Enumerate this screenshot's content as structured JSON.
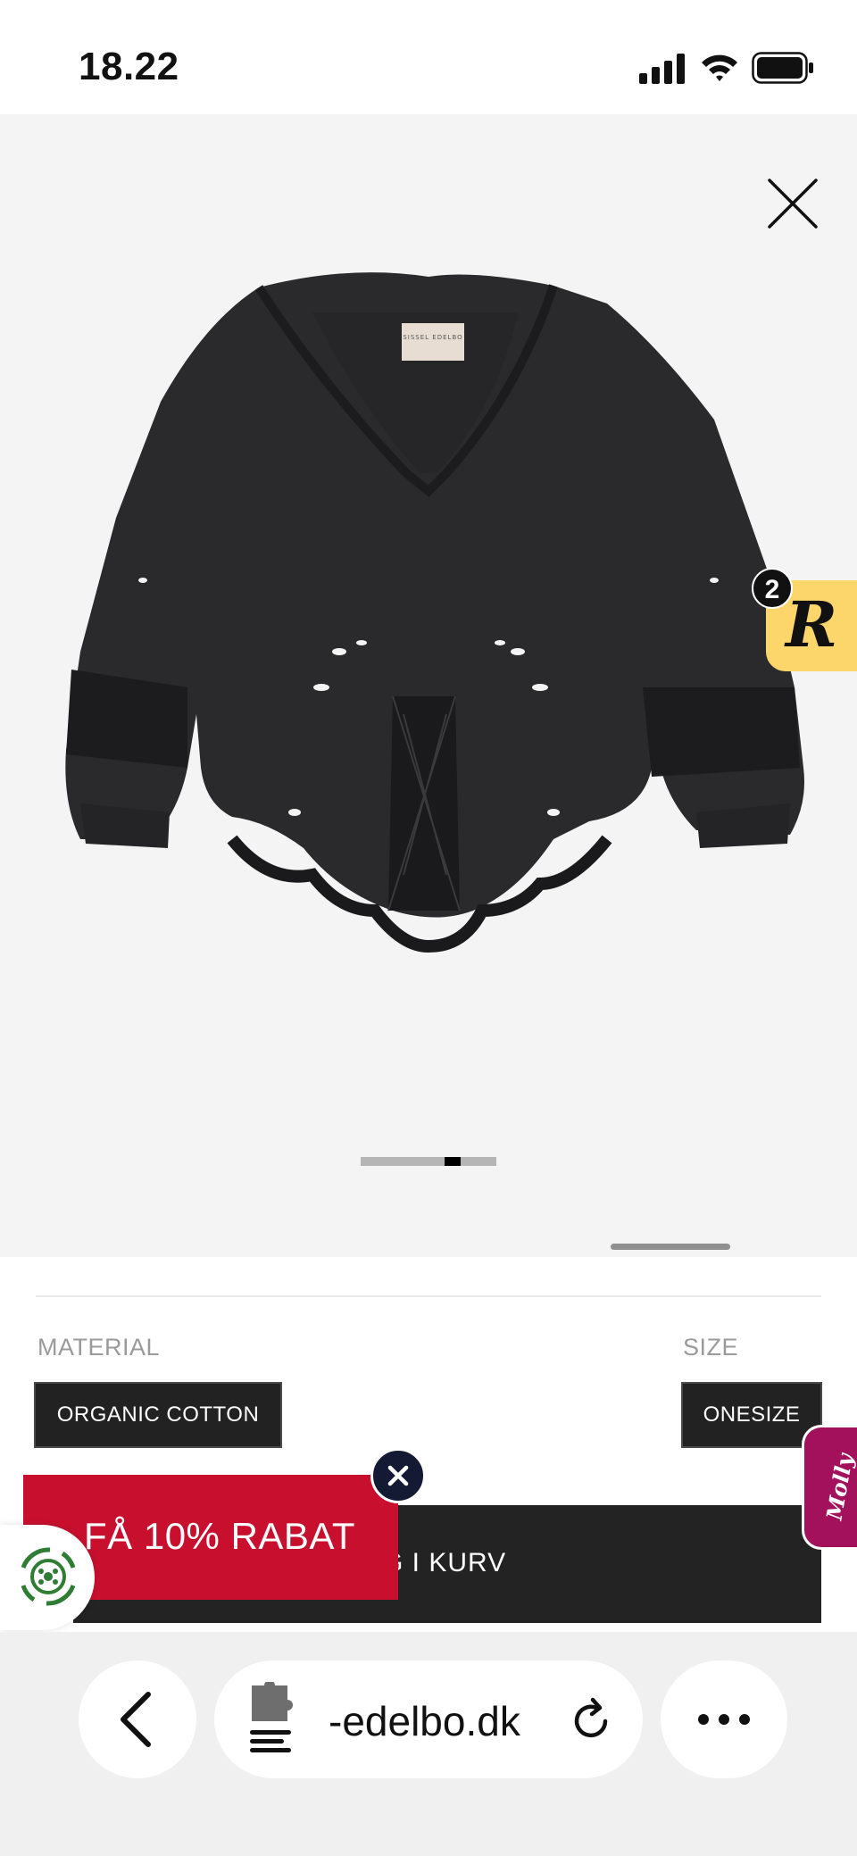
{
  "status_bar": {
    "time": "18.22",
    "signal_icon": "cellular-signal-icon",
    "wifi_icon": "wifi-icon",
    "battery_icon": "battery-icon"
  },
  "gallery": {
    "image_subject": "black embroidered broderie anglaise blouse",
    "garment_label_text": "SISSEL EDELBO",
    "close_icon": "close-icon",
    "progress_fraction": 0.12,
    "progress_position_fraction": 0.7
  },
  "review_badge": {
    "letter": "R",
    "count": "2",
    "color": "#fcd56b"
  },
  "details": {
    "material": {
      "label": "MATERIAL",
      "value": "ORGANIC COTTON"
    },
    "size": {
      "label": "SIZE",
      "value": "ONESIZE"
    },
    "add_to_cart_label": "G I KURV"
  },
  "promo": {
    "text": "FÅ 10% RABAT",
    "color": "#c8102e",
    "close_icon": "close-icon"
  },
  "molly_widget": {
    "label": "Molly",
    "color": "#a3115c"
  },
  "recycle_badge": {
    "icon": "recycle-icon"
  },
  "browser": {
    "url": "-edelbo.dk",
    "back_icon": "chevron-left-icon",
    "extension_icon": "puzzle-extension-icon",
    "reload_icon": "reload-icon",
    "more_icon": "more-icon"
  }
}
